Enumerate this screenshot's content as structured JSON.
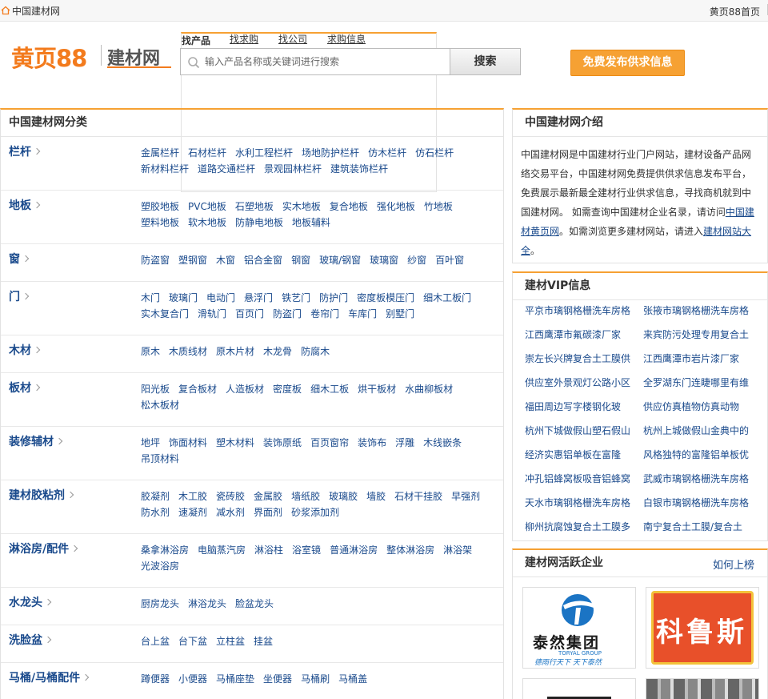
{
  "topbar": {
    "home_label": "中国建材网",
    "right_link": "黄页88首页"
  },
  "header": {
    "logo_main": "黄页88",
    "logo_sub": "建材网",
    "tabs": [
      "找产品",
      "找求购",
      "找公司",
      "求购信息"
    ],
    "search_placeholder": "输入产品名称或关键词进行搜索",
    "search_button": "搜索",
    "publish_button": "免费发布供求信息"
  },
  "categories": {
    "title": "中国建材网分类",
    "rows": [
      {
        "name": "栏杆",
        "links": [
          "金属栏杆",
          "石材栏杆",
          "水利工程栏杆",
          "场地防护栏杆",
          "仿木栏杆",
          "仿石栏杆",
          "新材料栏杆",
          "道路交通栏杆",
          "景观园林栏杆",
          "建筑装饰栏杆"
        ]
      },
      {
        "name": "地板",
        "links": [
          "塑胶地板",
          "PVC地板",
          "石塑地板",
          "实木地板",
          "复合地板",
          "强化地板",
          "竹地板",
          "塑料地板",
          "软木地板",
          "防静电地板",
          "地板辅料"
        ]
      },
      {
        "name": "窗",
        "links": [
          "防盗窗",
          "塑钢窗",
          "木窗",
          "铝合金窗",
          "钢窗",
          "玻璃/钢窗",
          "玻璃窗",
          "纱窗",
          "百叶窗"
        ]
      },
      {
        "name": "门",
        "links": [
          "木门",
          "玻璃门",
          "电动门",
          "悬浮门",
          "铁艺门",
          "防护门",
          "密度板模压门",
          "细木工板门",
          "实木复合门",
          "滑轨门",
          "百页门",
          "防盗门",
          "卷帘门",
          "车库门",
          "别墅门"
        ]
      },
      {
        "name": "木材",
        "links": [
          "原木",
          "木质线材",
          "原木片材",
          "木龙骨",
          "防腐木"
        ]
      },
      {
        "name": "板材",
        "links": [
          "阳光板",
          "复合板材",
          "人造板材",
          "密度板",
          "细木工板",
          "烘干板材",
          "水曲柳板材",
          "松木板材"
        ]
      },
      {
        "name": "装修辅材",
        "links": [
          "地坪",
          "饰面材料",
          "塑木材料",
          "装饰原纸",
          "百页窗帘",
          "装饰布",
          "浮雕",
          "木线嵌条",
          "吊顶材料"
        ]
      },
      {
        "name": "建材胶粘剂",
        "links": [
          "胶凝剂",
          "木工胶",
          "瓷砖胶",
          "金属胶",
          "墙纸胶",
          "玻璃胶",
          "墙胶",
          "石材干挂胶",
          "早强剂",
          "防水剂",
          "速凝剂",
          "减水剂",
          "界面剂",
          "砂浆添加剂"
        ]
      },
      {
        "name": "淋浴房/配件",
        "links": [
          "桑拿淋浴房",
          "电脑蒸汽房",
          "淋浴柱",
          "浴室镜",
          "普通淋浴房",
          "整体淋浴房",
          "淋浴架",
          "光波浴房"
        ]
      },
      {
        "name": "水龙头",
        "links": [
          "厨房龙头",
          "淋浴龙头",
          "脸盆龙头"
        ]
      },
      {
        "name": "洗脸盆",
        "links": [
          "台上盆",
          "台下盆",
          "立柱盆",
          "挂盆"
        ]
      },
      {
        "name": "马桶/马桶配件",
        "links": [
          "蹲便器",
          "小便器",
          "马桶座垫",
          "坐便器",
          "马桶刷",
          "马桶盖"
        ]
      }
    ]
  },
  "intro": {
    "title": "中国建材网介绍",
    "text_before": "中国建材网是中国建材行业门户网站，建材设备产品网络交易平台，中国建材网免费提供供求信息发布平台，免费展示最新最全建材行业供求信息，寻找商机就到中国建材网。 如需查询中国建材企业名录，请访问",
    "link1": "中国建材黄页网",
    "text_middle": "。如需浏览更多建材网站，请进入",
    "link2": "建材网站大全",
    "text_after": "。"
  },
  "vip": {
    "title": "建材VIP信息",
    "items": [
      "平京市璃钢格栅洗车房格",
      "张掖市璃钢格栅洗车房格",
      "江西鹰潭市氟碳漆厂家",
      "来宾防污处理专用复合土",
      "崇左长兴牌复合土工膜供",
      "江西鹰潭市岩片漆厂家",
      "供应室外景观灯公路小区",
      "全罗湖东门连睫哪里有维",
      "福田周边写字楼钢化玻",
      "供应仿真植物仿真动物",
      "杭州下城做假山塑石假山",
      "杭州上城做假山金典中的",
      "经济实惠铝单板在富隆",
      "风格独特的富隆铝单板优",
      "冲孔铝蜂窝板吸音铝蜂窝",
      "武威市璃钢格栅洗车房格",
      "天水市璃钢格栅洗车房格",
      "白银市璃钢格栅洗车房格",
      "柳州抗腐蚀复合土工膜多",
      "南宁复合土工膜/复合土"
    ]
  },
  "active": {
    "title": "建材网活跃企业",
    "how_link": "如何上榜",
    "logo1_text": "泰然集团",
    "logo1_en": "TORYAL GROUP",
    "logo1_slogan": "德雨行天下 天下泰然",
    "logo2_text": "科鲁斯"
  },
  "colors": {
    "accent": "#f6a133",
    "brand_orange": "#f37b1d",
    "link_blue": "#1a4a8c"
  }
}
